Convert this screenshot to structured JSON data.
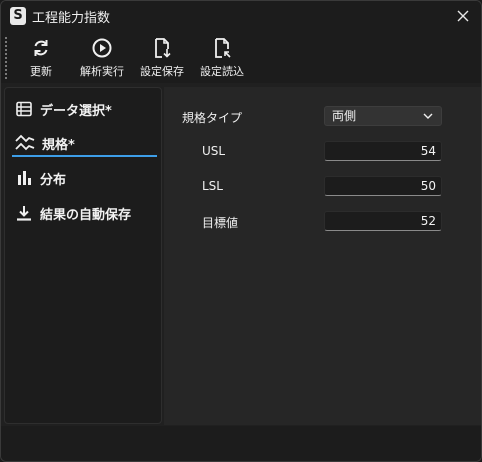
{
  "window": {
    "title": "工程能力指数",
    "app_icon_letter": "S"
  },
  "toolbar": {
    "refresh": "更新",
    "run": "解析実行",
    "save_settings": "設定保存",
    "load_settings": "設定読込"
  },
  "sidebar": {
    "items": [
      {
        "label": "データ選択*",
        "icon": "table-icon"
      },
      {
        "label": "規格*",
        "icon": "spec-wave-icon",
        "active": true
      },
      {
        "label": "分布",
        "icon": "bar-chart-icon"
      },
      {
        "label": "結果の自動保存",
        "icon": "download-icon"
      }
    ]
  },
  "spec": {
    "type_label": "規格タイプ",
    "type_value": "両側",
    "usl_label": "USL",
    "usl_value": "54",
    "lsl_label": "LSL",
    "lsl_value": "50",
    "target_label": "目標値",
    "target_value": "52"
  },
  "colors": {
    "accent": "#3d9ee8",
    "background": "#202020"
  }
}
